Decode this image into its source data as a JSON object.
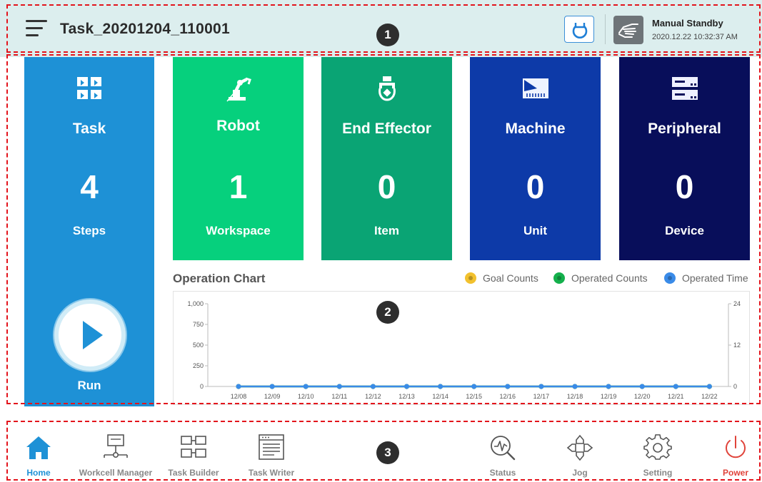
{
  "header": {
    "task_name": "Task_20201204_110001",
    "mode_title": "Manual Standby",
    "mode_time": "2020.12.22 10:32:37 AM"
  },
  "cards": {
    "task": {
      "title": "Task",
      "count": "4",
      "sub": "Steps",
      "run_label": "Run"
    },
    "robot": {
      "title": "Robot",
      "count": "1",
      "sub": "Workspace"
    },
    "effector": {
      "title": "End Effector",
      "count": "0",
      "sub": "Item"
    },
    "machine": {
      "title": "Machine",
      "count": "0",
      "sub": "Unit"
    },
    "peripheral": {
      "title": "Peripheral",
      "count": "0",
      "sub": "Device"
    }
  },
  "chart": {
    "title": "Operation Chart",
    "legend": [
      {
        "label": "Goal Counts",
        "color": "#f2c12e"
      },
      {
        "label": "Operated Counts",
        "color": "#14b04c"
      },
      {
        "label": "Operated Time",
        "color": "#3a8be8"
      }
    ]
  },
  "chart_data": {
    "type": "line",
    "title": "Operation Chart",
    "categories": [
      "12/08",
      "12/09",
      "12/10",
      "12/11",
      "12/12",
      "12/13",
      "12/14",
      "12/15",
      "12/16",
      "12/17",
      "12/18",
      "12/19",
      "12/20",
      "12/21",
      "12/22"
    ],
    "y_ticks_left": [
      "1,000",
      "750",
      "500",
      "250",
      "0"
    ],
    "y_ticks_right": [
      "24",
      "12",
      "0"
    ],
    "ylim_left": [
      0,
      1000
    ],
    "ylim_right": [
      0,
      24
    ],
    "series": [
      {
        "name": "Goal Counts",
        "color": "#f2c12e",
        "values": [
          0,
          0,
          0,
          0,
          0,
          0,
          0,
          0,
          0,
          0,
          0,
          0,
          0,
          0,
          0
        ]
      },
      {
        "name": "Operated Counts",
        "color": "#14b04c",
        "values": [
          0,
          0,
          0,
          0,
          0,
          0,
          0,
          0,
          0,
          0,
          0,
          0,
          0,
          0,
          0
        ]
      },
      {
        "name": "Operated Time",
        "color": "#3a8be8",
        "values": [
          0,
          0,
          0,
          0,
          0,
          0,
          0,
          0,
          0,
          0,
          0,
          0,
          0,
          0,
          0
        ]
      }
    ],
    "legend": "top-right",
    "grid": false
  },
  "nav": {
    "home": "Home",
    "workcell": "Workcell Manager",
    "task_builder": "Task Builder",
    "task_writer": "Task Writer",
    "status": "Status",
    "jog": "Jog",
    "setting": "Setting",
    "power": "Power"
  },
  "markers": [
    "1",
    "2",
    "3"
  ],
  "colors": {
    "header_bg": "#dceeee",
    "task_card": "#1e91d6",
    "robot_card": "#06d07d",
    "effector_card": "#0aa474",
    "machine_card": "#0d3aa8",
    "peripheral_card": "#080e5a",
    "annotation": "#e3141c"
  }
}
